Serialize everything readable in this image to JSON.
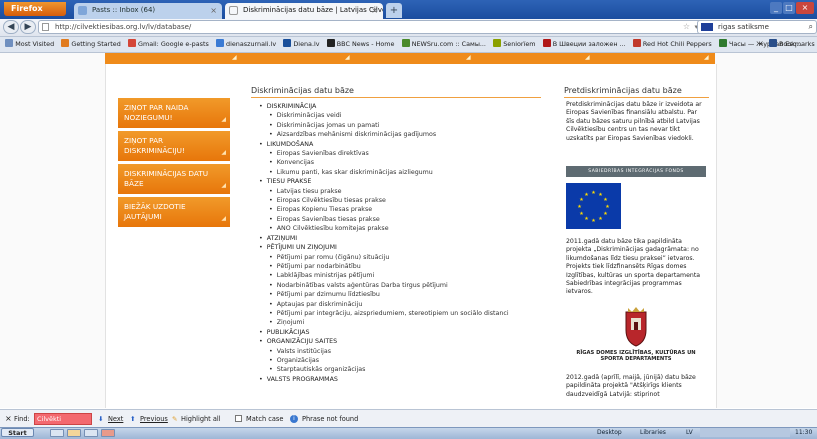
{
  "browser": {
    "menu_button": "Firefox",
    "tabs": [
      {
        "title": "Pasts :: Inbox (64)"
      },
      {
        "title": "Diskriminācijas datu bāze | Latvijas Cilvē..."
      }
    ],
    "new_tab": "+",
    "url": "http://cilvektiesibas.org.lv/lv/database/",
    "search_value": "rigas satiksme",
    "bookmarks": [
      {
        "label": "Most Visited",
        "color": "#6f8fbf"
      },
      {
        "label": "Getting Started",
        "color": "#e07b1f"
      },
      {
        "label": "Gmail: Google e-pasts",
        "color": "#d44638"
      },
      {
        "label": "dienaszurnali.lv",
        "color": "#3b7bd4"
      },
      {
        "label": "Diena.lv",
        "color": "#1a4f9a"
      },
      {
        "label": "BBC News - Home",
        "color": "#222222"
      },
      {
        "label": "NEWSru.com :: Самы...",
        "color": "#4a8a2a"
      },
      {
        "label": "Seniorïem",
        "color": "#8aa000"
      },
      {
        "label": "В Швеции заложен ...",
        "color": "#b01818"
      },
      {
        "label": "Red Hot Chili Peppers",
        "color": "#c0392b"
      },
      {
        "label": "Часы — Журнал Esq...",
        "color": "#2f7a2f"
      },
      {
        "label": "Bookmarks",
        "color": "#2a4f8a"
      }
    ],
    "overflow_chevron": "»"
  },
  "site": {
    "nav_boxes": [
      {
        "label": "Ziņot par naida noziegumu!"
      },
      {
        "label": "Ziņot par diskrimināciju!"
      },
      {
        "label": "Diskriminācijas datu bāze"
      },
      {
        "label": "Biežāk uzdotie jautājumi"
      }
    ],
    "main_title": "Diskriminācijas datu bāze",
    "tree": [
      {
        "label": "DISKRIMINĀCIJA",
        "children": [
          "Diskriminācijas veidi",
          "Diskriminācijas jomas un pamati",
          "Aizsardzības mehānismi diskriminācijas gadījumos"
        ]
      },
      {
        "label": "LIKUMDOŠANA",
        "children": [
          "Eiropas Savienības direktīvas",
          "Konvencijas",
          "Likumu panti, kas skar diskriminācijas aizliegumu"
        ]
      },
      {
        "label": "TIESU PRAKSE",
        "children": [
          "Latvijas tiesu prakse",
          "Eiropas Cilvēktiesību tiesas prakse",
          "Eiropas Kopienu Tiesas prakse",
          "Eiropas Savienības tiesas prakse",
          "ANO Cilvēktiesību komitejas prakse"
        ]
      },
      {
        "label": "ATZIŅUMI",
        "children": []
      },
      {
        "label": "PĒTĪJUMI UN ZIŅOJUMI",
        "children": [
          "Pētījumi par romu (čigānu) situāciju",
          "Pētījumi par nodarbinātību",
          "Labklājības ministrijas pētījumi",
          "Nodarbinātības valsts aģentūras Darba tirgus pētījumi",
          "Pētījumi par dzimumu līdztiesību",
          "Aptaujas par diskrimināciju",
          "Pētījumi par integrāciju, aizspriedumiem, stereotipiem un sociālo distanci",
          "Ziņojumi"
        ]
      },
      {
        "label": "PUBLIKĀCIJAS",
        "children": []
      },
      {
        "label": "ORGANIZĀCIJU SAITES",
        "children": [
          "Valsts institūcijas",
          "Organizācijas",
          "Starptautiskās organizācijas"
        ]
      },
      {
        "label": "VALSTS PROGRAMMAS",
        "children": []
      }
    ],
    "side_title": "Pretdiskriminācijas datu bāze",
    "side_p1": "Pretdiskriminācijas datu bāze ir izveidota ar Eiropas Savienības finansiālu atbalstu. Par šīs datu bāzes saturu pilnībā atbild Latvijas Cilvēktiesību centrs un tas nevar tikt uzskatīts par Eiropas Savienības viedokli.",
    "fund_logo": "SABIEDRĪBAS INTEGRĀCIJAS FONDS",
    "side_p2": "2011.gadā datu bāze tika papildināta projekta „Diskriminācijas gadagrāmata: no likumdošanas līdz tiesu praksei” ietvaros. Projekts tiek līdzfinansēts Rīgas domes Izglītības, kultūras un sporta departamenta Sabiedrības integrācijas programmas ietvaros.",
    "riga_logo_text": "RĪGAS DOMES IZGLĪTĪBAS, KULTŪRAS UN SPORTA DEPARTAMENTS",
    "side_p3": "2012.gadā (aprīlī, maijā, jūnijā) datu bāze papildināta projektā \"Atšķirīgs klients daudzveidīgā Latvijā: stiprinot"
  },
  "findbar": {
    "close": "×",
    "label": "Find:",
    "value": "Cilvēkti",
    "next": "Next",
    "previous": "Previous",
    "highlight": "Highlight all",
    "match_case": "Match case",
    "status": "Phrase not found"
  },
  "taskbar": {
    "start": "Start",
    "desktop": "Desktop",
    "libraries": "Libraries",
    "lang": "LV",
    "time": "11:30"
  }
}
